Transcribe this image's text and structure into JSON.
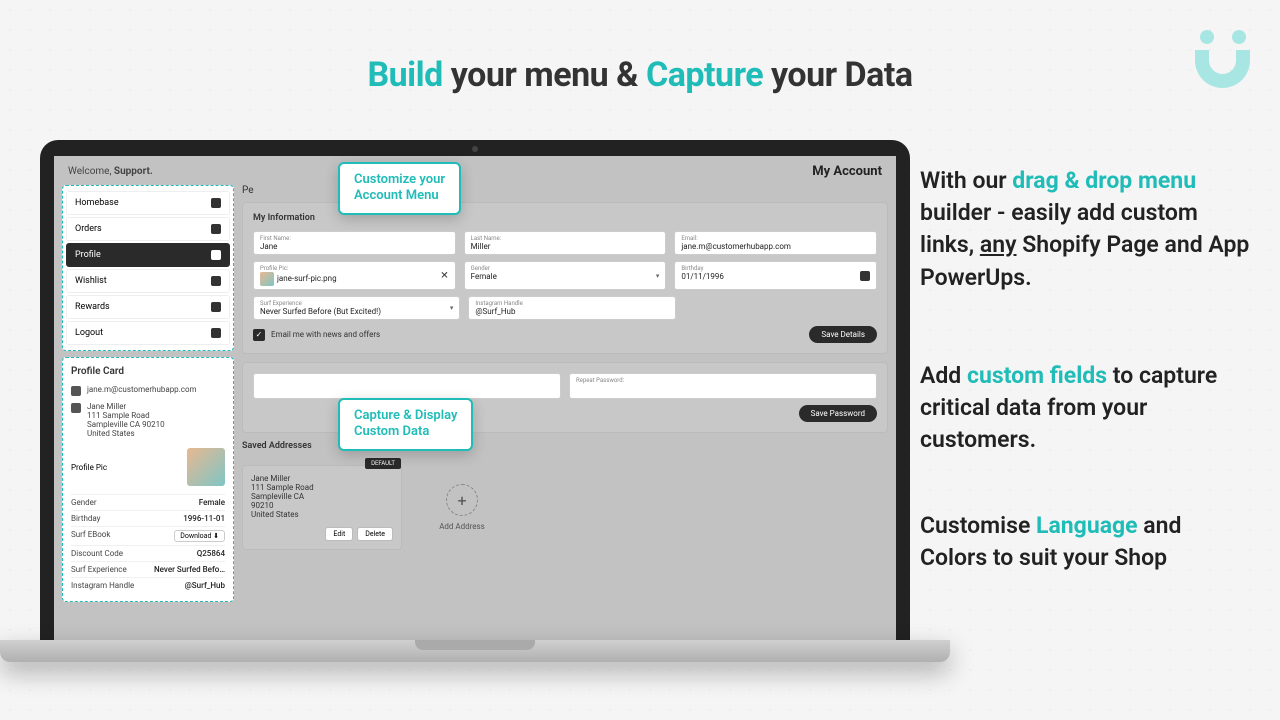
{
  "hero": {
    "build": "Build",
    "mid1": " your menu & ",
    "capture": "Capture",
    "mid2": " your Data"
  },
  "side": {
    "p1a": "With our ",
    "p1b": "drag & drop menu",
    "p1c": " builder - easily add custom links, ",
    "p1d": "any",
    "p1e": " Shopify Page and App PowerUps.",
    "p2a": "Add ",
    "p2b": "custom fields",
    "p2c": " to capture critical data from your customers.",
    "p3a": "Customise ",
    "p3b": "Language",
    "p3c": " and Colors to suit your Shop"
  },
  "callouts": {
    "menu": "Customize your\nAccount Menu",
    "data": "Capture & Display\nCustom Data"
  },
  "header": {
    "welcome_pre": "Welcome, ",
    "welcome_name": "Support.",
    "account_title": "My Account"
  },
  "menu": [
    {
      "label": "Homebase",
      "icon": "user-icon"
    },
    {
      "label": "Orders",
      "icon": "cart-icon"
    },
    {
      "label": "Profile",
      "icon": "user-icon",
      "active": true
    },
    {
      "label": "Wishlist",
      "icon": "star-icon"
    },
    {
      "label": "Rewards",
      "icon": "bulb-icon"
    },
    {
      "label": "Logout",
      "icon": "logout-icon"
    }
  ],
  "profile_card": {
    "title": "Profile Card",
    "email": "jane.m@customerhubapp.com",
    "name": "Jane Miller",
    "addr1": "111 Sample Road",
    "addr2": "Sampleville CA 90210",
    "country": "United States",
    "fields": [
      {
        "k": "Gender",
        "v": "Female"
      },
      {
        "k": "Birthday",
        "v": "1996-11-01"
      },
      {
        "k": "Surf EBook",
        "v": "Download ⬇"
      },
      {
        "k": "Discount Code",
        "v": "Q25864"
      },
      {
        "k": "Surf Experience",
        "v": "Never Surfed Befo…"
      },
      {
        "k": "Instagram Handle",
        "v": "@Surf_Hub"
      }
    ],
    "profile_pic_label": "Profile Pic"
  },
  "info": {
    "header": "Pe",
    "section_title": "My Information",
    "first_name": {
      "label": "First Name:",
      "value": "Jane"
    },
    "last_name": {
      "label": "Last Name:",
      "value": "Miller"
    },
    "email": {
      "label": "Email:",
      "value": "jane.m@customerhubapp.com"
    },
    "profile_pic": {
      "label": "Profile Pic:",
      "value": "jane-surf-pic.png"
    },
    "gender": {
      "label": "Gender",
      "value": "Female"
    },
    "birthday": {
      "label": "Birthday",
      "value": "01/11/1996"
    },
    "surf": {
      "label": "Surf Experience",
      "value": "Never Surfed Before (But Excited!)"
    },
    "insta": {
      "label": "Instagram Handle",
      "value": "@Surf_Hub"
    },
    "email_opt": "Email me with news and offers",
    "save_btn": "Save Details"
  },
  "password": {
    "repeat_label": "Repeat Password:",
    "save_btn": "Save Password"
  },
  "addresses": {
    "title": "Saved Addresses",
    "default_badge": "DEFAULT",
    "card": {
      "name": "Jane Miller",
      "l1": "111 Sample Road",
      "l2": "Sampleville CA",
      "zip": "90210",
      "country": "United States"
    },
    "edit": "Edit",
    "delete": "Delete",
    "add": "Add Address"
  }
}
